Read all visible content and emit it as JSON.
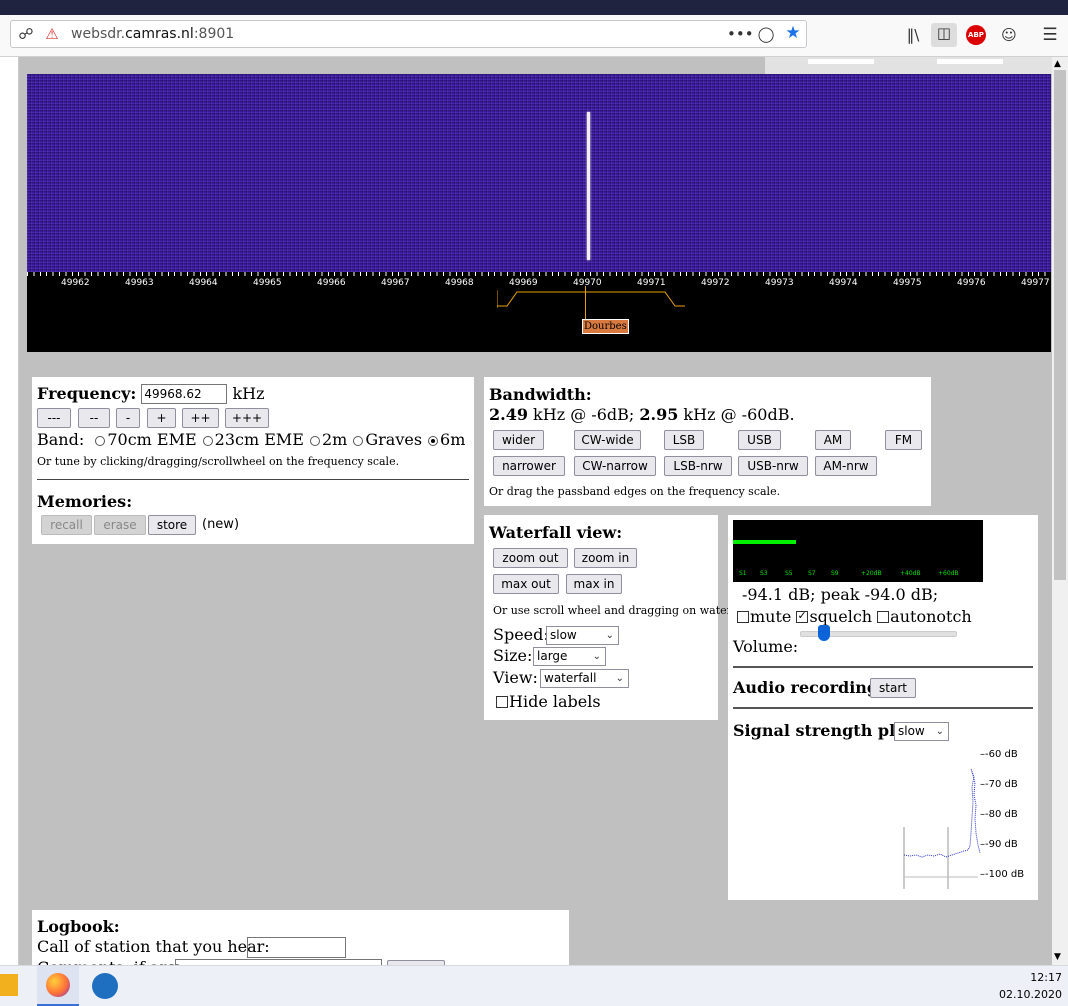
{
  "browser": {
    "url_host_prefix": "websdr.",
    "url_host": "camras.nl",
    "url_port": ":8901",
    "menu_dots": "•••",
    "abp_label": "ABP"
  },
  "waterfall": {
    "scale_labels": [
      "49962",
      "49963",
      "49964",
      "49965",
      "49966",
      "49967",
      "49968",
      "49969",
      "49970",
      "49971",
      "49972",
      "49973",
      "49974",
      "49975",
      "49976",
      "49977"
    ],
    "station_label": "Dourbes"
  },
  "frequency_panel": {
    "title": "Frequency:",
    "value": "49968.62",
    "unit": "kHz",
    "step_buttons": [
      "---",
      "--",
      "-",
      "+",
      "++",
      "+++"
    ],
    "band_label": "Band:",
    "bands": [
      {
        "label": "70cm EME",
        "selected": false
      },
      {
        "label": "23cm EME",
        "selected": false
      },
      {
        "label": "2m",
        "selected": false
      },
      {
        "label": "Graves",
        "selected": false
      },
      {
        "label": "6m",
        "selected": true
      }
    ],
    "hint": "Or tune by clicking/dragging/scrollwheel on the frequency scale.",
    "memories_title": "Memories:",
    "recall": "recall",
    "erase": "erase",
    "store": "store",
    "new_label": "(new)"
  },
  "bandwidth_panel": {
    "title": "Bandwidth:",
    "bw6": "2.49",
    "bw6_text": " kHz @ -6dB; ",
    "bw60": "2.95",
    "bw60_text": " kHz @ -60dB.",
    "row1": [
      "wider",
      "CW-wide",
      "LSB",
      "USB",
      "AM",
      "FM"
    ],
    "row2": [
      "narrower",
      "CW-narrow",
      "LSB-nrw",
      "USB-nrw",
      "AM-nrw"
    ],
    "hint": "Or drag the passband edges on the frequency scale."
  },
  "waterfall_view_panel": {
    "title": "Waterfall view:",
    "zoom_out": "zoom out",
    "zoom_in": "zoom in",
    "max_out": "max out",
    "max_in": "max in",
    "hint": "Or use scroll wheel and dragging on waterfall.",
    "speed_label": "Speed:",
    "speed_value": "slow",
    "size_label": "Size:",
    "size_value": "large",
    "view_label": "View:",
    "view_value": "waterfall",
    "hide_labels": "Hide labels",
    "hide_labels_checked": false
  },
  "audio_panel": {
    "smeter_labels": [
      "S1",
      "S3",
      "S5",
      "S7",
      "S9",
      "+20dB",
      "+40dB",
      "+60dB"
    ],
    "level_text": "-94.1 dB; peak   -94.0 dB;",
    "mute": "mute",
    "mute_checked": false,
    "squelch": "squelch",
    "squelch_checked": true,
    "autonotch": "autonotch",
    "autonotch_checked": false,
    "volume_label": "Volume:",
    "recording_label": "Audio recording:",
    "recording_button": "start",
    "plot_label": "Signal strength plot:",
    "plot_speed": "slow",
    "plot_axis": [
      "-60 dB",
      "-70 dB",
      "-80 dB",
      "-90 dB",
      "-100 dB"
    ]
  },
  "logbook": {
    "title": "Logbook:",
    "call_label": "Call of station that you hear:",
    "comment_label": "Comments, if any:"
  },
  "taskbar": {
    "time": "12:17",
    "date": "02.10.2020"
  }
}
